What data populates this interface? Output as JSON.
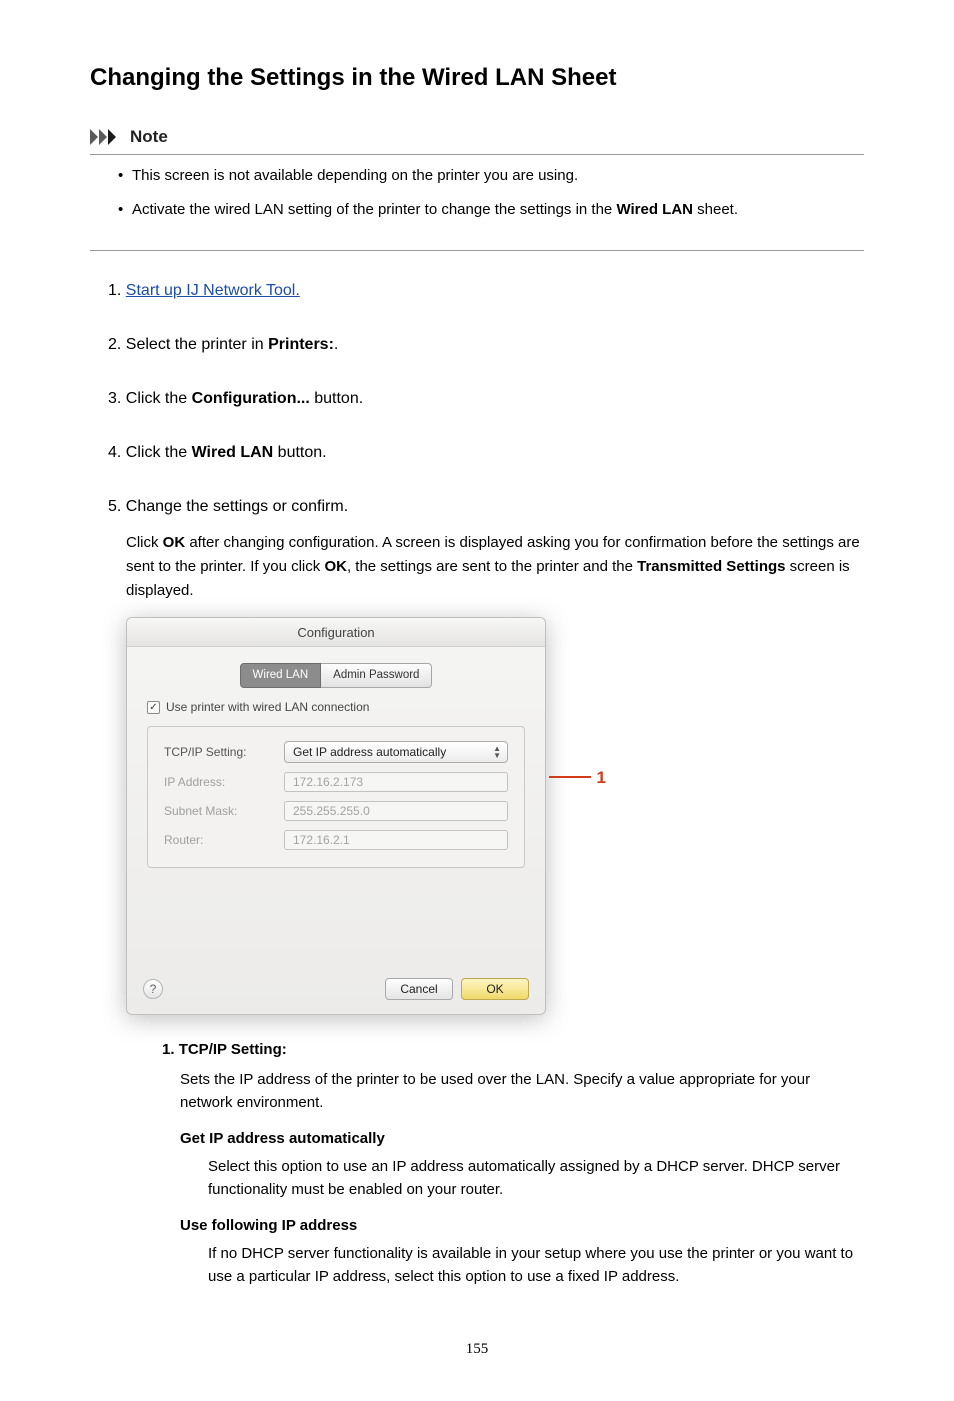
{
  "title": "Changing the Settings in the Wired LAN Sheet",
  "note": {
    "label": "Note",
    "items": [
      "This screen is not available depending on the printer you are using.",
      "Activate the wired LAN setting of the printer to change the settings in the "
    ],
    "wired_lan_bold": "Wired LAN",
    "sheet_tail": " sheet."
  },
  "steps": {
    "s1_link": "Start up IJ Network Tool.",
    "s2_a": "Select the printer in ",
    "s2_bold": "Printers:",
    "s2_b": ".",
    "s3_a": "Click the ",
    "s3_bold": "Configuration...",
    "s3_b": " button.",
    "s4_a": "Click the ",
    "s4_bold": "Wired LAN",
    "s4_b": " button.",
    "s5": "Change the settings or confirm.",
    "s5_desc_a": "Click ",
    "s5_desc_ok1": "OK",
    "s5_desc_b": " after changing configuration. A screen is displayed asking you for confirmation before the settings are sent to the printer. If you click ",
    "s5_desc_ok2": "OK",
    "s5_desc_c": ", the settings are sent to the printer and the ",
    "s5_desc_trans": "Transmitted Settings",
    "s5_desc_d": " screen is displayed."
  },
  "dialog": {
    "title": "Configuration",
    "tab_active": "Wired LAN",
    "tab_other": "Admin Password",
    "checkbox_label": "Use printer with wired LAN connection",
    "tcpip_label": "TCP/IP Setting:",
    "tcpip_value": "Get IP address automatically",
    "ip_label": "IP Address:",
    "ip_value": "172.16.2.173",
    "mask_label": "Subnet Mask:",
    "mask_value": "255.255.255.0",
    "router_label": "Router:",
    "router_value": "172.16.2.1",
    "help": "?",
    "cancel": "Cancel",
    "ok": "OK",
    "callout": "1"
  },
  "sub": {
    "s1_title": "TCP/IP Setting:",
    "s1_desc": "Sets the IP address of the printer to be used over the LAN. Specify a value appropriate for your network environment.",
    "opt1_title": "Get IP address automatically",
    "opt1_desc": "Select this option to use an IP address automatically assigned by a DHCP server. DHCP server functionality must be enabled on your router.",
    "opt2_title": "Use following IP address",
    "opt2_desc": "If no DHCP server functionality is available in your setup where you use the printer or you want to use a particular IP address, select this option to use a fixed IP address."
  },
  "page_number": "155"
}
